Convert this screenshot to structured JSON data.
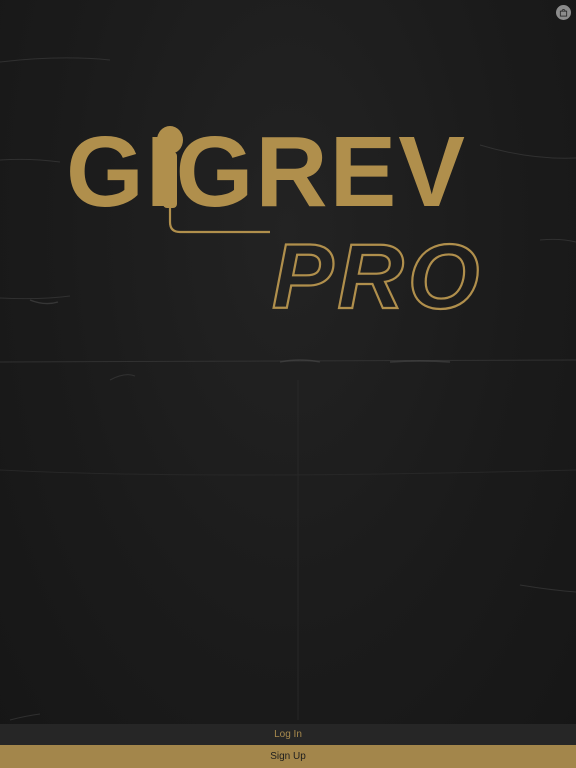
{
  "logo": {
    "word": "GIGREV",
    "sub": "PRO"
  },
  "actions": {
    "login_label": "Log In",
    "signup_label": "Sign Up"
  },
  "colors": {
    "background": "#1a1a1a",
    "gold": "#b08f4c",
    "signup_bg": "#a3864b",
    "login_bg": "#262626"
  },
  "icons": {
    "corner": "shopping-bag-icon"
  }
}
